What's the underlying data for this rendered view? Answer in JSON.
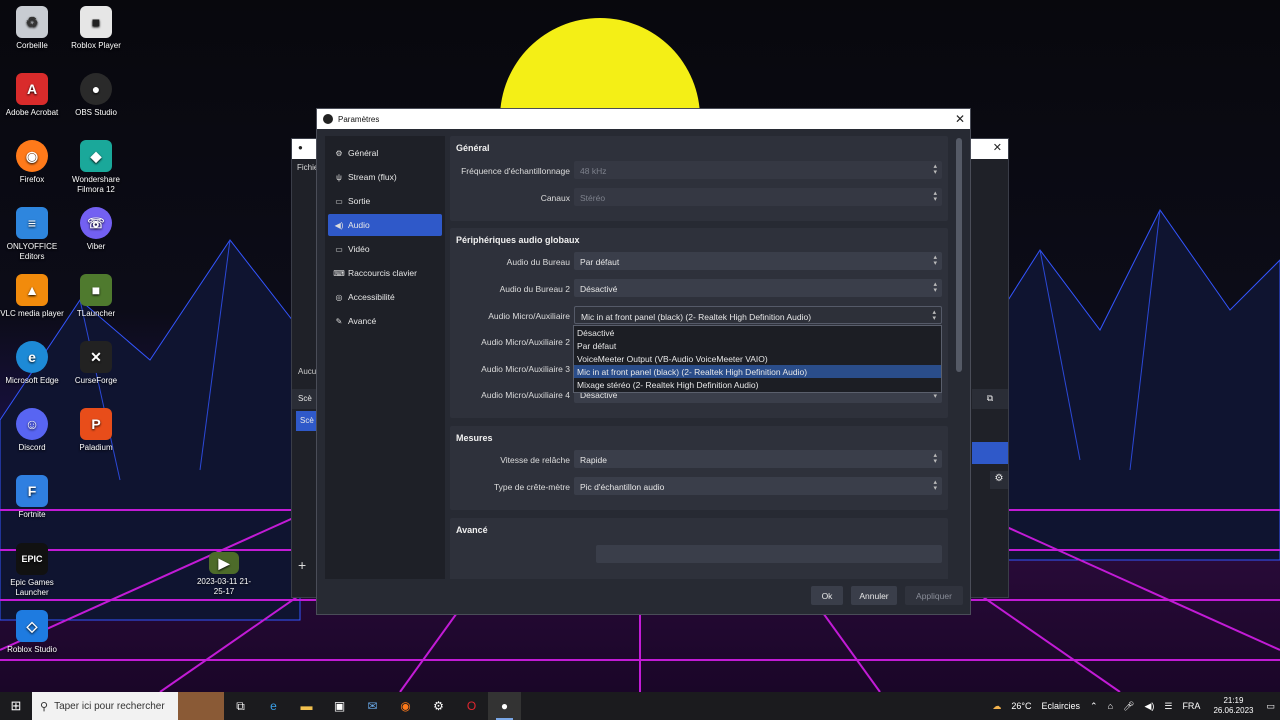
{
  "desktop": {
    "icons": [
      {
        "label": "Corbeille",
        "icon": "recycle-bin-icon",
        "color": "#c8ccd2",
        "glyph": "♻"
      },
      {
        "label": "Roblox Player",
        "icon": "roblox-icon",
        "color": "#e6e6e6",
        "glyph": "■"
      },
      {
        "label": "Adobe Acrobat",
        "icon": "acrobat-icon",
        "color": "#d92b2b",
        "glyph": "A"
      },
      {
        "label": "OBS Studio",
        "icon": "obs-icon",
        "color": "#2a2a2a",
        "glyph": "●"
      },
      {
        "label": "Firefox",
        "icon": "firefox-icon",
        "color": "#ff7a1a",
        "glyph": "◉"
      },
      {
        "label": "Wondershare Filmora 12",
        "icon": "filmora-icon",
        "color": "#1aa89a",
        "glyph": "◆"
      },
      {
        "label": "ONLYOFFICE Editors",
        "icon": "onlyoffice-icon",
        "color": "#2e86de",
        "glyph": "≡"
      },
      {
        "label": "Viber",
        "icon": "viber-icon",
        "color": "#7360f2",
        "glyph": "☏"
      },
      {
        "label": "VLC media player",
        "icon": "vlc-icon",
        "color": "#f28b0c",
        "glyph": "▲"
      },
      {
        "label": "TLauncher",
        "icon": "tlauncher-icon",
        "color": "#4f7a2e",
        "glyph": "■"
      },
      {
        "label": "Microsoft Edge",
        "icon": "edge-icon",
        "color": "#1d8ad6",
        "glyph": "e"
      },
      {
        "label": "CurseForge",
        "icon": "curseforge-icon",
        "color": "#222222",
        "glyph": "✕"
      },
      {
        "label": "Discord",
        "icon": "discord-icon",
        "color": "#5865f2",
        "glyph": "☺"
      },
      {
        "label": "Paladium",
        "icon": "paladium-icon",
        "color": "#e84d1a",
        "glyph": "P"
      },
      {
        "label": "Fortnite",
        "icon": "fortnite-icon",
        "color": "#2f7fe0",
        "glyph": "F"
      },
      {
        "label": "Epic Games Launcher",
        "icon": "epic-games-icon",
        "color": "#111111",
        "glyph": "EPIC"
      },
      {
        "label": "2023-03-11 21-25-17",
        "icon": "video-file-icon",
        "color": "#4d6b2a",
        "glyph": "▶"
      },
      {
        "label": "Roblox Studio",
        "icon": "roblox-studio-icon",
        "color": "#1e7be0",
        "glyph": "◇"
      }
    ]
  },
  "obs_background": {
    "menu_label": "Fichie",
    "side_labels": [
      "Aucu",
      "Scè",
      "Scè"
    ]
  },
  "dialog": {
    "title": "Paramètres",
    "sidebar": [
      {
        "label": "Général",
        "icon": "gear-icon",
        "glyph": "⚙"
      },
      {
        "label": "Stream (flux)",
        "icon": "antenna-icon",
        "glyph": "ψ"
      },
      {
        "label": "Sortie",
        "icon": "output-icon",
        "glyph": "▭"
      },
      {
        "label": "Audio",
        "icon": "speaker-icon",
        "glyph": "◀)"
      },
      {
        "label": "Vidéo",
        "icon": "monitor-icon",
        "glyph": "▭"
      },
      {
        "label": "Raccourcis clavier",
        "icon": "keyboard-icon",
        "glyph": "⌨"
      },
      {
        "label": "Accessibilité",
        "icon": "accessibility-icon",
        "glyph": "◎"
      },
      {
        "label": "Avancé",
        "icon": "wrench-icon",
        "glyph": "✎"
      }
    ],
    "active_section": "Audio",
    "general": {
      "heading": "Général",
      "sample_rate_label": "Fréquence d'échantillonnage",
      "sample_rate_value": "48 kHz",
      "channels_label": "Canaux",
      "channels_value": "Stéréo"
    },
    "global_devices": {
      "heading": "Périphériques audio globaux",
      "rows": [
        {
          "label": "Audio du Bureau",
          "value": "Par défaut"
        },
        {
          "label": "Audio du Bureau 2",
          "value": "Désactivé"
        },
        {
          "label": "Audio Micro/Auxiliaire",
          "value": "Mic in at front panel (black) (2- Realtek High Definition Audio)"
        },
        {
          "label": "Audio Micro/Auxiliaire 2",
          "value": ""
        },
        {
          "label": "Audio Micro/Auxiliaire 3",
          "value": ""
        },
        {
          "label": "Audio Micro/Auxiliaire 4",
          "value": "Désactivé"
        }
      ]
    },
    "dropdown_options": [
      "Désactivé",
      "Par défaut",
      "VoiceMeeter Output (VB-Audio VoiceMeeter VAIO)",
      "Mic in at front panel (black) (2- Realtek High Definition Audio)",
      "Mixage stéréo (2- Realtek High Definition Audio)"
    ],
    "dropdown_highlighted": 3,
    "meters": {
      "heading": "Mesures",
      "decay_label": "Vitesse de relâche",
      "decay_value": "Rapide",
      "peak_label": "Type de crête-mètre",
      "peak_value": "Pic d'échantillon audio"
    },
    "advanced": {
      "heading": "Avancé"
    },
    "buttons": {
      "ok": "Ok",
      "cancel": "Annuler",
      "apply": "Appliquer"
    }
  },
  "taskbar": {
    "search_placeholder": "Taper ici pour rechercher",
    "weather": "26°C",
    "weather_text": "Eclaircies",
    "language": "FRA",
    "time": "21:19",
    "date": "26.06.2023",
    "accent": "#2f59c9"
  }
}
